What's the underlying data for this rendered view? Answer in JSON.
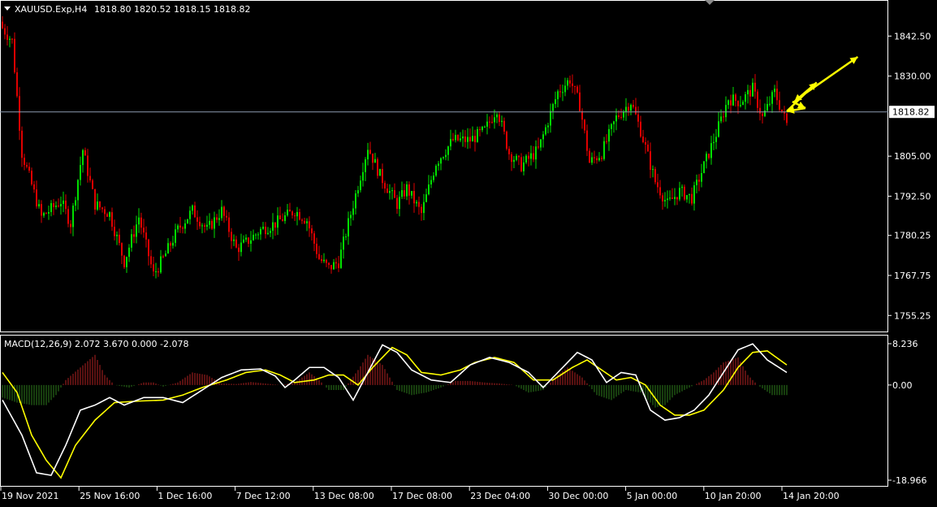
{
  "header": {
    "symbol_label": "XAUUSD.Exp,H4",
    "ohlc": "1818.80 1820.52 1818.15 1818.82"
  },
  "price_axis": {
    "ticks": [
      "1842.50",
      "1830.00",
      "1805.00",
      "1792.50",
      "1780.25",
      "1767.75",
      "1755.25"
    ],
    "current_price_label": "1818.82"
  },
  "macd": {
    "label": "MACD(12,26,9) 2.072 3.670 0.000 -2.078",
    "axis_ticks": [
      "8.236",
      "0.00",
      "-18.966"
    ]
  },
  "time_axis": {
    "labels": [
      "19 Nov 2021",
      "25 Nov 16:00",
      "1 Dec 16:00",
      "7 Dec 12:00",
      "13 Dec 08:00",
      "17 Dec 08:00",
      "23 Dec 04:00",
      "30 Dec 00:00",
      "5 Jan 00:00",
      "10 Jan 20:00",
      "14 Jan 20:00"
    ]
  },
  "colors": {
    "background": "#000000",
    "bull_candle": "#00e000",
    "bear_candle": "#e00000",
    "signal_line": "#ffff00",
    "macd_line": "#ffffff",
    "hist_positive": "#b22222",
    "hist_negative": "#2e7d1c",
    "arrows": "#ffff00",
    "grid_border": "#ffffff"
  },
  "chart_data": [
    {
      "type": "candlestick",
      "title": "XAUUSD.Exp,H4",
      "timeframe": "H4",
      "ylim": [
        1751,
        1853
      ],
      "current_price": 1818.82,
      "price_line_value": 1818.82,
      "anchors": [
        [
          0,
          1845
        ],
        [
          4,
          1841
        ],
        [
          8,
          1806
        ],
        [
          16,
          1786
        ],
        [
          24,
          1791
        ],
        [
          28,
          1784
        ],
        [
          33,
          1807
        ],
        [
          38,
          1790
        ],
        [
          44,
          1787
        ],
        [
          50,
          1772
        ],
        [
          56,
          1786
        ],
        [
          62,
          1768
        ],
        [
          66,
          1773
        ],
        [
          72,
          1782
        ],
        [
          78,
          1788
        ],
        [
          84,
          1782
        ],
        [
          90,
          1788
        ],
        [
          96,
          1776
        ],
        [
          100,
          1778
        ],
        [
          106,
          1782
        ],
        [
          112,
          1784
        ],
        [
          120,
          1788
        ],
        [
          125,
          1785
        ],
        [
          130,
          1773
        ],
        [
          134,
          1770
        ],
        [
          138,
          1772
        ],
        [
          145,
          1793
        ],
        [
          150,
          1808
        ],
        [
          155,
          1799
        ],
        [
          162,
          1790
        ],
        [
          166,
          1795
        ],
        [
          172,
          1787
        ],
        [
          178,
          1803
        ],
        [
          185,
          1810
        ],
        [
          192,
          1810
        ],
        [
          198,
          1813
        ],
        [
          203,
          1820
        ],
        [
          208,
          1806
        ],
        [
          213,
          1802
        ],
        [
          220,
          1807
        ],
        [
          228,
          1825
        ],
        [
          233,
          1829
        ],
        [
          237,
          1821
        ],
        [
          241,
          1803
        ],
        [
          246,
          1806
        ],
        [
          252,
          1817
        ],
        [
          258,
          1822
        ],
        [
          262,
          1813
        ],
        [
          268,
          1797
        ],
        [
          273,
          1790
        ],
        [
          278,
          1794
        ],
        [
          283,
          1792
        ],
        [
          288,
          1802
        ],
        [
          293,
          1812
        ],
        [
          298,
          1823
        ],
        [
          303,
          1822
        ],
        [
          308,
          1826
        ],
        [
          312,
          1817
        ],
        [
          317,
          1825
        ],
        [
          322,
          1815
        ]
      ],
      "projection_arrows": [
        [
          [
            1819.5,
            1822
          ],
          [
            1823,
            1820
          ]
        ],
        [
          [
            1823,
            1820
          ],
          [
            1818,
            1819
          ]
        ],
        [
          [
            1818,
            1819
          ],
          [
            1826,
            1828
          ]
        ],
        [
          [
            1826,
            1828
          ],
          [
            1820,
            1822
          ]
        ],
        [
          [
            1821,
            1823
          ],
          [
            1837,
            1836
          ]
        ]
      ]
    },
    {
      "type": "line",
      "title": "MACD(12,26,9) 2.072 3.670 0.000 -2.078",
      "ylim": [
        -18.966,
        8.236
      ],
      "x_range": [
        0,
        322
      ],
      "series": [
        {
          "color": "#ffffff",
          "points": [
            [
              0,
              -3
            ],
            [
              8,
              -10
            ],
            [
              14,
              -17.5
            ],
            [
              20,
              -18
            ],
            [
              26,
              -12
            ],
            [
              32,
              -5
            ],
            [
              38,
              -4
            ],
            [
              44,
              -2.5
            ],
            [
              50,
              -4
            ],
            [
              58,
              -2.5
            ],
            [
              66,
              -2.5
            ],
            [
              74,
              -3.5
            ],
            [
              82,
              -1
            ],
            [
              90,
              1.5
            ],
            [
              98,
              3
            ],
            [
              106,
              3.2
            ],
            [
              112,
              1.8
            ],
            [
              116,
              -0.5
            ],
            [
              120,
              1
            ],
            [
              126,
              3.5
            ],
            [
              132,
              3.5
            ],
            [
              138,
              1.5
            ],
            [
              144,
              -3
            ],
            [
              150,
              2.5
            ],
            [
              156,
              8
            ],
            [
              162,
              6.5
            ],
            [
              168,
              3
            ],
            [
              176,
              1
            ],
            [
              184,
              0.5
            ],
            [
              192,
              4
            ],
            [
              200,
              5.5
            ],
            [
              208,
              4.5
            ],
            [
              216,
              2.5
            ],
            [
              222,
              -0.5
            ],
            [
              228,
              2.5
            ],
            [
              236,
              6.5
            ],
            [
              242,
              5
            ],
            [
              248,
              0.5
            ],
            [
              254,
              2.5
            ],
            [
              260,
              2
            ],
            [
              266,
              -5
            ],
            [
              272,
              -7
            ],
            [
              278,
              -6.5
            ],
            [
              284,
              -5
            ],
            [
              290,
              -2
            ],
            [
              296,
              2.5
            ],
            [
              302,
              7
            ],
            [
              308,
              8.2
            ],
            [
              314,
              5
            ],
            [
              322,
              2.5
            ]
          ]
        },
        {
          "color": "#ffff00",
          "points": [
            [
              0,
              2.5
            ],
            [
              6,
              -1.5
            ],
            [
              12,
              -10
            ],
            [
              18,
              -15
            ],
            [
              24,
              -18.5
            ],
            [
              30,
              -12
            ],
            [
              38,
              -7
            ],
            [
              46,
              -3.5
            ],
            [
              56,
              -3.2
            ],
            [
              66,
              -3
            ],
            [
              74,
              -2
            ],
            [
              82,
              -0.5
            ],
            [
              92,
              1
            ],
            [
              100,
              2.5
            ],
            [
              108,
              3
            ],
            [
              114,
              2
            ],
            [
              120,
              0.5
            ],
            [
              128,
              1
            ],
            [
              134,
              2
            ],
            [
              140,
              2
            ],
            [
              146,
              0
            ],
            [
              152,
              3.5
            ],
            [
              160,
              7.5
            ],
            [
              166,
              6
            ],
            [
              172,
              2.5
            ],
            [
              180,
              2
            ],
            [
              188,
              3
            ],
            [
              194,
              4.5
            ],
            [
              202,
              5.5
            ],
            [
              210,
              4.5
            ],
            [
              218,
              1
            ],
            [
              226,
              1
            ],
            [
              234,
              3.5
            ],
            [
              240,
              5
            ],
            [
              246,
              3
            ],
            [
              252,
              1
            ],
            [
              258,
              1.5
            ],
            [
              264,
              0
            ],
            [
              270,
              -4
            ],
            [
              276,
              -6
            ],
            [
              282,
              -6
            ],
            [
              288,
              -5
            ],
            [
              296,
              -1
            ],
            [
              302,
              3.5
            ],
            [
              308,
              6.5
            ],
            [
              314,
              6.8
            ],
            [
              322,
              4
            ]
          ]
        }
      ],
      "histogram": {
        "points": [
          [
            0,
            -2.5
          ],
          [
            6,
            -3.5
          ],
          [
            12,
            -4
          ],
          [
            18,
            -4
          ],
          [
            22,
            -2
          ],
          [
            26,
            1
          ],
          [
            32,
            3.5
          ],
          [
            38,
            6
          ],
          [
            42,
            2
          ],
          [
            46,
            0
          ],
          [
            52,
            -0.5
          ],
          [
            58,
            0.5
          ],
          [
            62,
            0.5
          ],
          [
            66,
            -0.3
          ],
          [
            72,
            0.5
          ],
          [
            78,
            2.5
          ],
          [
            84,
            2
          ],
          [
            90,
            0.3
          ],
          [
            96,
            0.2
          ],
          [
            102,
            0.6
          ],
          [
            108,
            0.3
          ],
          [
            114,
            0
          ],
          [
            120,
            0.5
          ],
          [
            126,
            2.5
          ],
          [
            130,
            1
          ],
          [
            134,
            -1
          ],
          [
            140,
            -1
          ],
          [
            146,
            3
          ],
          [
            150,
            6
          ],
          [
            156,
            4
          ],
          [
            162,
            -1
          ],
          [
            168,
            -2
          ],
          [
            174,
            -1.5
          ],
          [
            180,
            -0.5
          ],
          [
            186,
            0.8
          ],
          [
            192,
            0.8
          ],
          [
            198,
            0.5
          ],
          [
            204,
            0.3
          ],
          [
            210,
            0
          ],
          [
            216,
            -1.5
          ],
          [
            222,
            -1
          ],
          [
            228,
            2
          ],
          [
            232,
            3.5
          ],
          [
            238,
            1.5
          ],
          [
            244,
            -2
          ],
          [
            250,
            -3
          ],
          [
            256,
            -1
          ],
          [
            262,
            -1.5
          ],
          [
            268,
            -4.5
          ],
          [
            272,
            -4
          ],
          [
            276,
            -2
          ],
          [
            282,
            -0.5
          ],
          [
            288,
            1
          ],
          [
            292,
            2.5
          ],
          [
            296,
            4.5
          ],
          [
            302,
            5.5
          ],
          [
            306,
            2
          ],
          [
            310,
            0
          ],
          [
            316,
            -2
          ],
          [
            322,
            -2
          ]
        ]
      }
    }
  ]
}
